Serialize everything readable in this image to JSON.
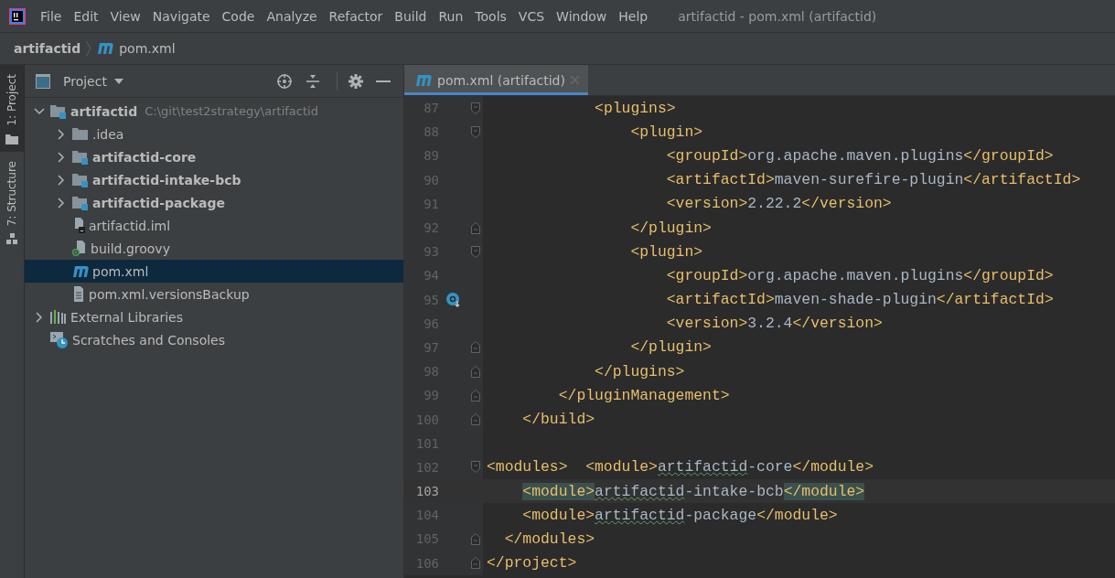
{
  "menu_bar": {
    "items": [
      "File",
      "Edit",
      "View",
      "Navigate",
      "Code",
      "Analyze",
      "Refactor",
      "Build",
      "Run",
      "Tools",
      "VCS",
      "Window",
      "Help"
    ],
    "title": "artifactid - pom.xml (artifactid)"
  },
  "breadcrumb": [
    {
      "label": "artifactid",
      "kind": "project"
    },
    {
      "label": "pom.xml",
      "kind": "maven"
    }
  ],
  "tool_strip": [
    {
      "label": "1: Project",
      "kind": "folder",
      "selected": true
    },
    {
      "label": "7: Structure",
      "kind": "structure",
      "selected": false
    }
  ],
  "project_panel": {
    "title": "Project",
    "tree": [
      {
        "label": "artifactid",
        "hint": "C:\\git\\test2strategy\\artifactid",
        "kind": "module",
        "expanded": true,
        "selected": false,
        "children": [
          {
            "label": ".idea",
            "kind": "folder",
            "expanded": false,
            "selected": false
          },
          {
            "label": "artifactid-core",
            "kind": "module",
            "expanded": false,
            "selected": false
          },
          {
            "label": "artifactid-intake-bcb",
            "kind": "module",
            "expanded": false,
            "selected": false
          },
          {
            "label": "artifactid-package",
            "kind": "module",
            "expanded": false,
            "selected": false
          },
          {
            "label": "artifactid.iml",
            "kind": "iml",
            "selected": false
          },
          {
            "label": "build.groovy",
            "kind": "groovy",
            "selected": false
          },
          {
            "label": "pom.xml",
            "kind": "maven",
            "selected": true
          },
          {
            "label": "pom.xml.versionsBackup",
            "kind": "text",
            "selected": false
          }
        ]
      },
      {
        "label": "External Libraries",
        "kind": "libraries",
        "expanded": false,
        "selected": false
      },
      {
        "label": "Scratches and Consoles",
        "kind": "scratches",
        "selected": false
      }
    ]
  },
  "editor": {
    "tabs": [
      {
        "label": "pom.xml (artifactid)",
        "selected": true
      }
    ],
    "lines": [
      {
        "number": "87",
        "fold_start": true,
        "fold_end": false,
        "maven_marker": false,
        "current": false,
        "tokens": [
          {
            "kind": "tag",
            "text": "            <plugins>"
          }
        ]
      },
      {
        "number": "88",
        "fold_start": true,
        "fold_end": false,
        "maven_marker": false,
        "current": false,
        "tokens": [
          {
            "kind": "tag",
            "text": "                <plugin>"
          }
        ]
      },
      {
        "number": "89",
        "fold_start": false,
        "fold_end": false,
        "maven_marker": false,
        "current": false,
        "tokens": [
          {
            "kind": "tag",
            "text": "                    <groupId>"
          },
          {
            "kind": "text",
            "text": "org.apache.maven.plugins"
          },
          {
            "kind": "tag",
            "text": "</groupId>"
          }
        ]
      },
      {
        "number": "90",
        "fold_start": false,
        "fold_end": false,
        "maven_marker": false,
        "current": false,
        "tokens": [
          {
            "kind": "tag",
            "text": "                    <artifactId>"
          },
          {
            "kind": "text",
            "text": "maven-surefire-plugin"
          },
          {
            "kind": "tag",
            "text": "</artifactId>"
          }
        ]
      },
      {
        "number": "91",
        "fold_start": false,
        "fold_end": false,
        "maven_marker": false,
        "current": false,
        "tokens": [
          {
            "kind": "tag",
            "text": "                    <version>"
          },
          {
            "kind": "text",
            "text": "2.22.2"
          },
          {
            "kind": "tag",
            "text": "</version>"
          }
        ]
      },
      {
        "number": "92",
        "fold_start": false,
        "fold_end": true,
        "maven_marker": false,
        "current": false,
        "tokens": [
          {
            "kind": "tag",
            "text": "                </plugin>"
          }
        ]
      },
      {
        "number": "93",
        "fold_start": true,
        "fold_end": false,
        "maven_marker": false,
        "current": false,
        "tokens": [
          {
            "kind": "tag",
            "text": "                <plugin>"
          }
        ]
      },
      {
        "number": "94",
        "fold_start": false,
        "fold_end": false,
        "maven_marker": false,
        "current": false,
        "tokens": [
          {
            "kind": "tag",
            "text": "                    <groupId>"
          },
          {
            "kind": "text",
            "text": "org.apache.maven.plugins"
          },
          {
            "kind": "tag",
            "text": "</groupId>"
          }
        ]
      },
      {
        "number": "95",
        "fold_start": false,
        "fold_end": false,
        "maven_marker": true,
        "current": false,
        "tokens": [
          {
            "kind": "tag",
            "text": "                    <artifactId>"
          },
          {
            "kind": "text",
            "text": "maven-shade-plugin"
          },
          {
            "kind": "tag",
            "text": "</artifactId>"
          }
        ]
      },
      {
        "number": "96",
        "fold_start": false,
        "fold_end": false,
        "maven_marker": false,
        "current": false,
        "tokens": [
          {
            "kind": "tag",
            "text": "                    <version>"
          },
          {
            "kind": "text",
            "text": "3.2.4"
          },
          {
            "kind": "tag",
            "text": "</version>"
          }
        ]
      },
      {
        "number": "97",
        "fold_start": false,
        "fold_end": true,
        "maven_marker": false,
        "current": false,
        "tokens": [
          {
            "kind": "tag",
            "text": "                </plugin>"
          }
        ]
      },
      {
        "number": "98",
        "fold_start": false,
        "fold_end": true,
        "maven_marker": false,
        "current": false,
        "tokens": [
          {
            "kind": "tag",
            "text": "            </plugins>"
          }
        ]
      },
      {
        "number": "99",
        "fold_start": false,
        "fold_end": true,
        "maven_marker": false,
        "current": false,
        "tokens": [
          {
            "kind": "tag",
            "text": "        </pluginManagement>"
          }
        ]
      },
      {
        "number": "100",
        "fold_start": false,
        "fold_end": true,
        "maven_marker": false,
        "current": false,
        "tokens": [
          {
            "kind": "tag",
            "text": "    </build>"
          }
        ]
      },
      {
        "number": "101",
        "fold_start": false,
        "fold_end": false,
        "maven_marker": false,
        "current": false
      },
      {
        "number": "102",
        "fold_start": true,
        "fold_end": false,
        "maven_marker": false,
        "current": false,
        "tokens": [
          {
            "kind": "tag",
            "text": "<modules>  <module>"
          },
          {
            "kind": "typo",
            "text": "artifactid"
          },
          {
            "kind": "text",
            "text": "-core"
          },
          {
            "kind": "tag",
            "text": "</module>"
          }
        ]
      },
      {
        "number": "103",
        "fold_start": false,
        "fold_end": false,
        "maven_marker": false,
        "current": true,
        "tokens": [
          {
            "kind": "match",
            "text": "    <module>"
          },
          {
            "kind": "typo",
            "text": "artifactid"
          },
          {
            "kind": "text",
            "text": "-intake-bcb"
          },
          {
            "kind": "match",
            "text": "</module>"
          }
        ]
      },
      {
        "number": "104",
        "fold_start": false,
        "fold_end": false,
        "maven_marker": false,
        "current": false,
        "tokens": [
          {
            "kind": "tag",
            "text": "    <module>"
          },
          {
            "kind": "typo",
            "text": "artifactid"
          },
          {
            "kind": "text",
            "text": "-package"
          },
          {
            "kind": "tag",
            "text": "</module>"
          }
        ]
      },
      {
        "number": "105",
        "fold_start": false,
        "fold_end": true,
        "maven_marker": false,
        "current": false,
        "tokens": [
          {
            "kind": "tag",
            "text": "  </modules>"
          }
        ]
      },
      {
        "number": "106",
        "fold_start": false,
        "fold_end": true,
        "maven_marker": false,
        "current": false,
        "tokens": [
          {
            "kind": "tag",
            "text": "</project>"
          }
        ]
      }
    ]
  }
}
